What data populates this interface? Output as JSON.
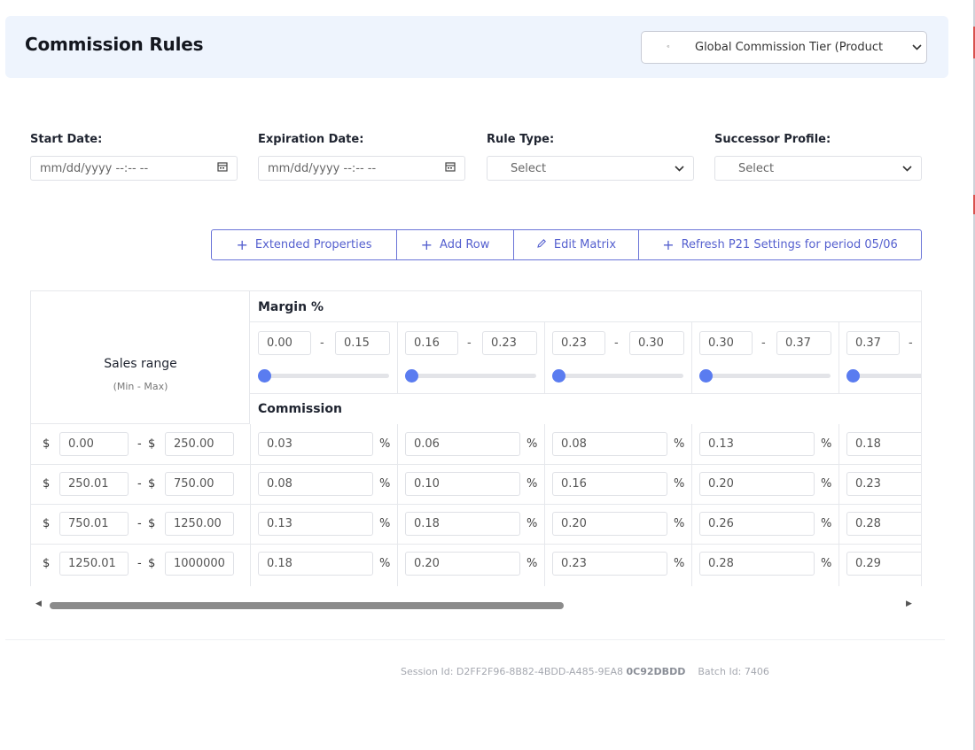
{
  "header": {
    "title": "Commission Rules",
    "profile_select": {
      "lead_glyph": "ᵉ",
      "value": "Global Commission Tier (Product"
    }
  },
  "filters": {
    "start_date": {
      "label": "Start Date:",
      "placeholder": "mm/dd/yyyy --:-- --"
    },
    "expiration_date": {
      "label": "Expiration Date:",
      "placeholder": "mm/dd/yyyy --:-- --"
    },
    "rule_type": {
      "label": "Rule Type:",
      "value": "Select"
    },
    "successor_profile": {
      "label": "Successor Profile:",
      "value": "Select"
    }
  },
  "toolbar": {
    "extended_properties": "Extended Properties",
    "add_row": "Add Row",
    "edit_matrix": "Edit Matrix",
    "refresh": "Refresh P21 Settings for period 05/06"
  },
  "matrix": {
    "sales_range_title": "Sales range",
    "sales_range_sub": "(Min - Max)",
    "margin_title": "Margin %",
    "commission_title": "Commission",
    "currency": "$",
    "range_dash": "-",
    "percent_sign": "%",
    "margin_columns": [
      {
        "min": "0.00",
        "max": "0.15",
        "slider": 0
      },
      {
        "min": "0.16",
        "max": "0.23",
        "slider": 0
      },
      {
        "min": "0.23",
        "max": "0.30",
        "slider": 0
      },
      {
        "min": "0.30",
        "max": "0.37",
        "slider": 0
      },
      {
        "min": "0.37",
        "max": "",
        "slider": 0
      }
    ],
    "rows": [
      {
        "min": "0.00",
        "max": "250.00",
        "commissions": [
          "0.03",
          "0.06",
          "0.08",
          "0.13",
          "0.18"
        ]
      },
      {
        "min": "250.01",
        "max": "750.00",
        "commissions": [
          "0.08",
          "0.10",
          "0.16",
          "0.20",
          "0.23"
        ]
      },
      {
        "min": "750.01",
        "max": "1250.00",
        "commissions": [
          "0.13",
          "0.18",
          "0.20",
          "0.26",
          "0.28"
        ]
      },
      {
        "min": "1250.01",
        "max": "1000000",
        "commissions": [
          "0.18",
          "0.20",
          "0.23",
          "0.28",
          "0.29"
        ]
      }
    ]
  },
  "footer": {
    "session_label": "Session Id:",
    "session_id_main": "D2FF2F96-8B82-4BDD-A485-9EA8",
    "session_id_bold": "0C92DBDD",
    "batch_label": "Batch Id:",
    "batch_id": "7406"
  },
  "colors": {
    "accent": "#5560cf",
    "slider": "#5a7cf0",
    "header_bg": "#eef4fd"
  }
}
